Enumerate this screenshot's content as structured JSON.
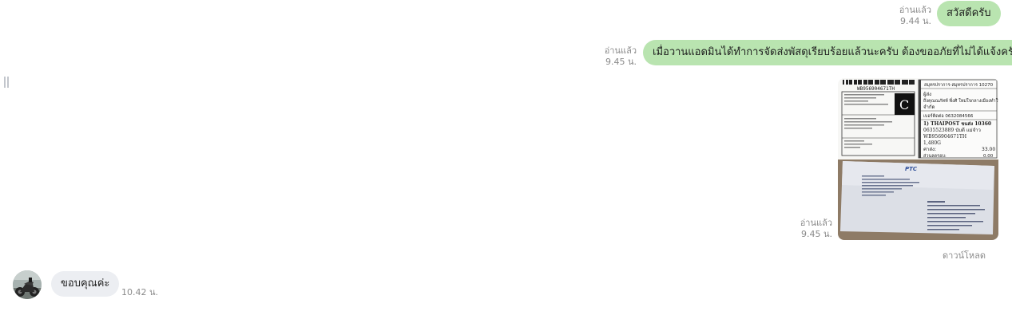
{
  "messages": [
    {
      "direction": "outgoing",
      "text": "สวัสดีครับ",
      "read_label": "อ่านแล้ว",
      "time": "9.44 น."
    },
    {
      "direction": "outgoing",
      "text": "เมื่อวานแอดมินได้ทำการจัดส่งพัสดุเรียบร้อยแล้วนะครับ ต้องขออภัยที่ไม่ได้แจ้งครับ",
      "read_label": "อ่านแล้ว",
      "time": "9.45 น."
    },
    {
      "direction": "outgoing",
      "type": "image",
      "read_label": "อ่านแล้ว",
      "time": "9.45 น.",
      "download_label": "ดาวน์โหลด",
      "receipt": {
        "tracking_top": "WB956904671TH",
        "c_mark": "C",
        "header": "สมุทรปราการ-สมุทรปราการ 10270",
        "line_sender": "ผู้ส่ง",
        "line_recipient": "ถึงคุณณภัทท์ พึ่งศิ ใหม่ใจกลางเมืองทำใหม่",
        "line_zip": "จำกัด",
        "line_phone": "เบอร์ติดต่อ 0632084566",
        "line_service": "1) THAIPOST ขนส่ง 10360",
        "line_ref": "0635523889 นับดี แม่จำว",
        "line_track": "WB956904671TH",
        "line_weight": "1,480G",
        "fee_label": "ค่าส่ง:",
        "fee_value": "33.00",
        "fee2_label": "ส่วนลดรอบ:",
        "fee2_value": "0.00"
      },
      "envelope": {
        "brand": "PTC"
      }
    },
    {
      "direction": "incoming",
      "text": "ขอบคุณค่ะ",
      "time": "10.42 น."
    }
  ],
  "colors": {
    "outgoing_bubble": "#b9e4b0",
    "incoming_bubble": "#eceef2",
    "meta_text": "#8a8a8a"
  }
}
